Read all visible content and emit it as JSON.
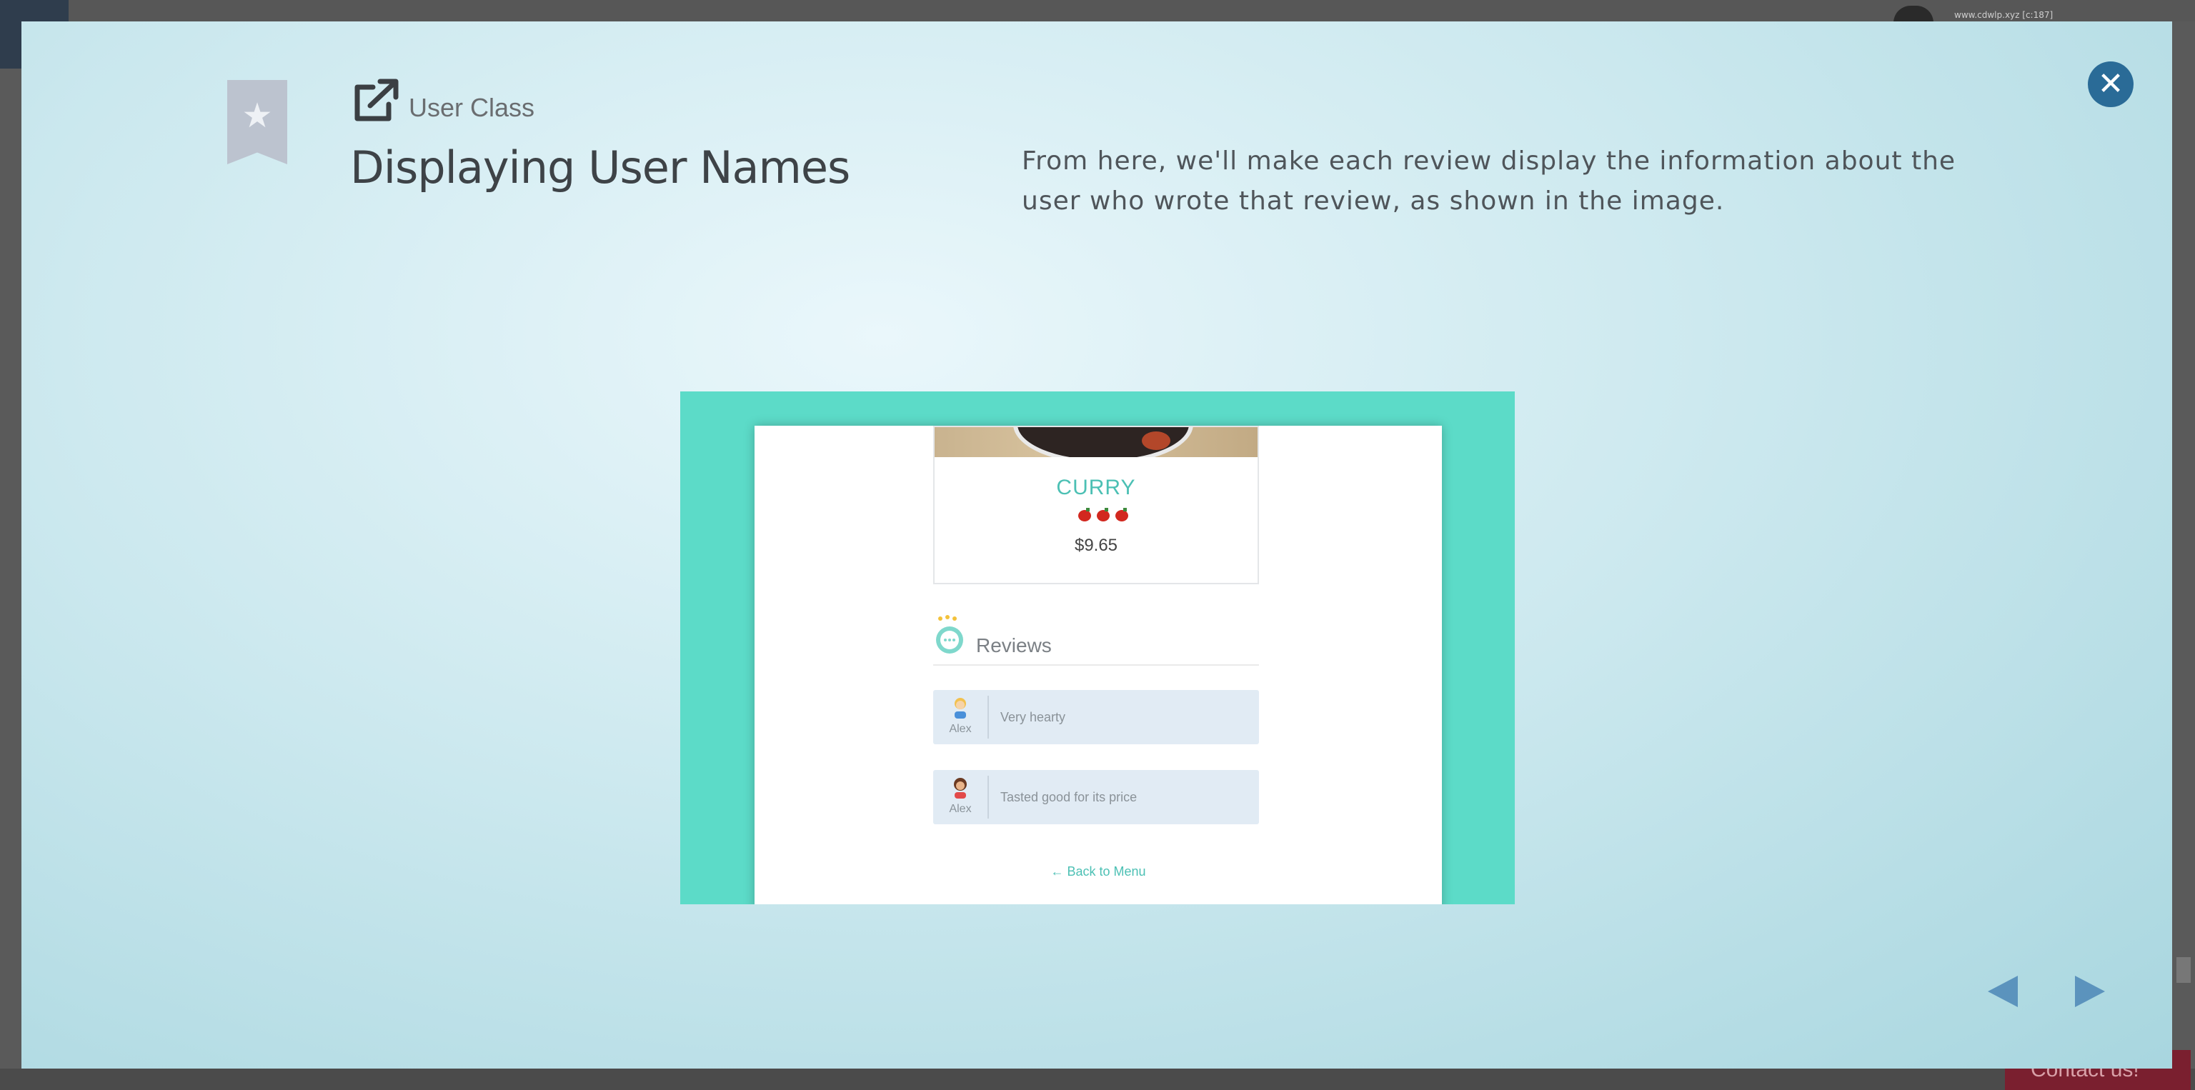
{
  "background": {
    "url_text": "www.cdwlp.xyz [c:187]",
    "contact_label": "Contact us!"
  },
  "modal": {
    "category": "User Class",
    "title": "Displaying User Names",
    "description": "From here, we'll make each review display the information about the user who wrote that review, as shown in the image.",
    "close_icon": "close-icon",
    "prev_icon": "triangle-left-icon",
    "next_icon": "triangle-right-icon",
    "accent_color": "#2a6b97"
  },
  "slide": {
    "dish": {
      "name": "CURRY",
      "spice_icon": "chili-pepper-icon",
      "spice_level": 3,
      "price": "$9.65"
    },
    "reviews_title": "Reviews",
    "reviews": [
      {
        "user": "Alex",
        "avatar": "user-avatar-blonde-icon",
        "text": "Very hearty"
      },
      {
        "user": "Alex",
        "avatar": "user-avatar-brunette-icon",
        "text": "Tasted good for its price"
      }
    ],
    "back_link": "← Back to Menu",
    "frame_color": "#5cdbc8"
  }
}
